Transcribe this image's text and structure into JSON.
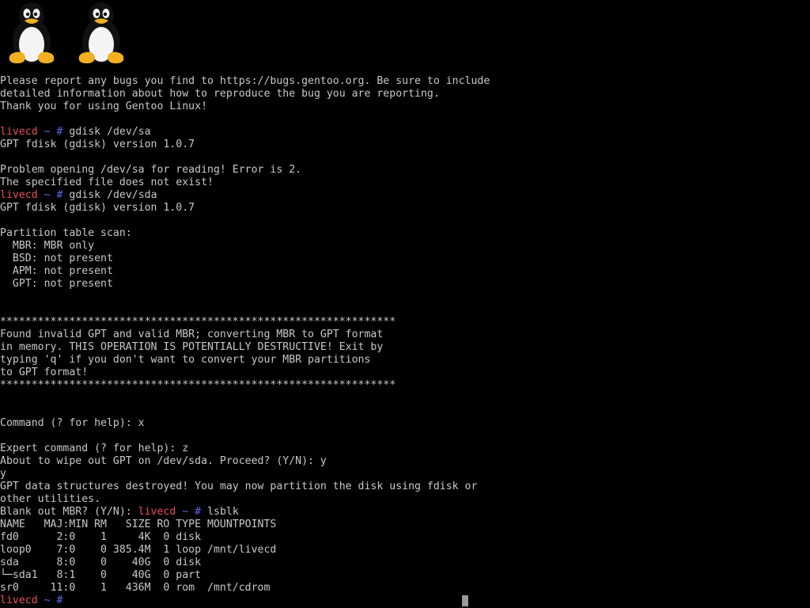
{
  "logos": [
    {
      "icon": "tux-penguin-icon"
    },
    {
      "icon": "tux-penguin-icon"
    }
  ],
  "colors": {
    "background": "#000000",
    "text": "#c8c8c8",
    "prompt_host": "#e8505a",
    "prompt_path": "#5e67e8"
  },
  "prompt": {
    "host": "livecd",
    "tilde": "~",
    "hash": "#"
  },
  "lines": [
    {
      "text": "Please report any bugs you find to https://bugs.gentoo.org. Be sure to include"
    },
    {
      "text": "detailed information about how to reproduce the bug you are reporting."
    },
    {
      "text": "Thank you for using Gentoo Linux!"
    },
    {
      "text": ""
    },
    {
      "prefix": "",
      "host": "livecd",
      "tilde": "~",
      "hash": "#",
      "cmd": " gdisk /dev/sa"
    },
    {
      "text": "GPT fdisk (gdisk) version 1.0.7"
    },
    {
      "text": ""
    },
    {
      "text": "Problem opening /dev/sa for reading! Error is 2."
    },
    {
      "text": "The specified file does not exist!"
    },
    {
      "prefix": "",
      "host": "livecd",
      "tilde": "~",
      "hash": "#",
      "cmd": " gdisk /dev/sda"
    },
    {
      "text": "GPT fdisk (gdisk) version 1.0.7"
    },
    {
      "text": ""
    },
    {
      "text": "Partition table scan:"
    },
    {
      "text": "  MBR: MBR only"
    },
    {
      "text": "  BSD: not present"
    },
    {
      "text": "  APM: not present"
    },
    {
      "text": "  GPT: not present"
    },
    {
      "text": ""
    },
    {
      "text": ""
    },
    {
      "text": "***************************************************************"
    },
    {
      "text": "Found invalid GPT and valid MBR; converting MBR to GPT format"
    },
    {
      "text": "in memory. THIS OPERATION IS POTENTIALLY DESTRUCTIVE! Exit by"
    },
    {
      "text": "typing 'q' if you don't want to convert your MBR partitions"
    },
    {
      "text": "to GPT format!"
    },
    {
      "text": "***************************************************************"
    },
    {
      "text": ""
    },
    {
      "text": ""
    },
    {
      "text": "Command (? for help): x"
    },
    {
      "text": ""
    },
    {
      "text": "Expert command (? for help): z"
    },
    {
      "text": "About to wipe out GPT on /dev/sda. Proceed? (Y/N): y"
    },
    {
      "text": "y"
    },
    {
      "text": "GPT data structures destroyed! You may now partition the disk using fdisk or"
    },
    {
      "text": "other utilities."
    },
    {
      "prefix": "Blank out MBR? (Y/N): ",
      "host": "livecd",
      "tilde": "~",
      "hash": "#",
      "cmd": " lsblk"
    },
    {
      "text": "NAME   MAJ:MIN RM   SIZE RO TYPE MOUNTPOINTS"
    },
    {
      "text": "fd0      2:0    1     4K  0 disk"
    },
    {
      "text": "loop0    7:0    0 385.4M  1 loop /mnt/livecd"
    },
    {
      "text": "sda      8:0    0    40G  0 disk"
    },
    {
      "text": "└─sda1   8:1    0    40G  0 part"
    },
    {
      "text": "sr0     11:0    1   436M  0 rom  /mnt/cdrom"
    },
    {
      "prefix": "",
      "host": "livecd",
      "tilde": "~",
      "hash": "#",
      "cmd": ""
    }
  ]
}
